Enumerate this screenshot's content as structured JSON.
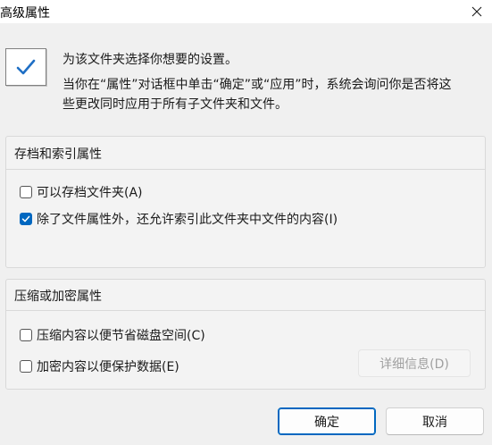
{
  "window": {
    "title": "高级属性"
  },
  "intro": {
    "line1": "为该文件夹选择你想要的设置。",
    "line2": "当你在“属性”对话框中单击“确定”或“应用”时，系统会询问你是否将这",
    "line3": "些更改同时应用于所有子文件夹和文件。"
  },
  "archive_group": {
    "title": "存档和索引属性",
    "options": [
      {
        "label": "可以存档文件夹(A)",
        "checked": false
      },
      {
        "label": "除了文件属性外，还允许索引此文件夹中文件的内容(I)",
        "checked": true
      }
    ]
  },
  "compress_group": {
    "title": "压缩或加密属性",
    "options": [
      {
        "label": "压缩内容以便节省磁盘空间(C)",
        "checked": false
      },
      {
        "label": "加密内容以便保护数据(E)",
        "checked": false
      }
    ],
    "details_button": "详细信息(D)"
  },
  "buttons": {
    "ok": "确定",
    "cancel": "取消"
  },
  "icons": {
    "close": "close-icon",
    "header": "checkbox-checked-icon",
    "checkmark": "checkmark-icon"
  },
  "colors": {
    "accent": "#0067c0",
    "window_bg": "#f0f0f0",
    "titlebar_bg": "#ffffff",
    "disabled_text": "#a0a0a0"
  }
}
